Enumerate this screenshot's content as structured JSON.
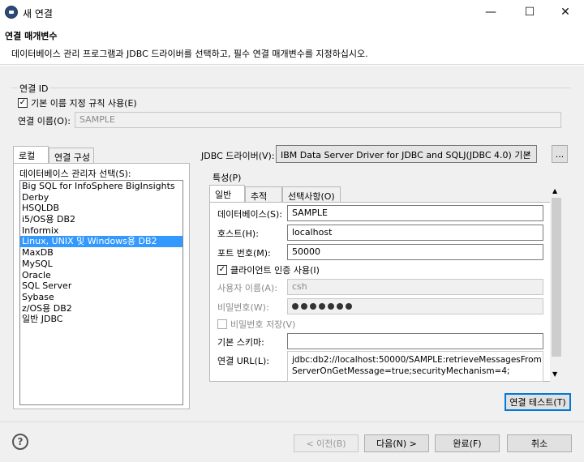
{
  "window": {
    "title": "새 연결",
    "minimize_glyph": "—",
    "maximize_glyph": "☐",
    "close_glyph": "✕"
  },
  "header": {
    "title": "연결 매개변수",
    "description": "데이터베이스 관리 프로그램과 JDBC 드라이버를 선택하고, 필수 연결 매개변수를 지정하십시오."
  },
  "connection_id": {
    "group_label": "연결 ID",
    "use_default_naming_label": "기본 이름 지정 규칙 사용(E)",
    "use_default_naming_checked": true,
    "name_label": "연결 이름(O):",
    "name_value": "SAMPLE"
  },
  "left_panel": {
    "tabs": [
      "로컬",
      "연결 구성"
    ],
    "list_label": "데이터베이스 관리자 선택(S):",
    "items": [
      "Big SQL for InfoSphere BigInsights",
      "Derby",
      "HSQLDB",
      "i5/OS용 DB2",
      "Informix",
      "Linux, UNIX 및 Windows용 DB2",
      "MaxDB",
      "MySQL",
      "Oracle",
      "SQL Server",
      "Sybase",
      "z/OS용 DB2",
      "일반 JDBC"
    ],
    "selected_index": 5
  },
  "driver": {
    "label": "JDBC 드라이버(V):",
    "selected": "IBM Data Server Driver for JDBC and SQLJ(JDBC 4.0) 기본",
    "browse_label": "..."
  },
  "properties": {
    "group_label": "특성(P)",
    "tabs": [
      "일반",
      "추적",
      "선택사항(O)"
    ],
    "database_label": "데이터베이스(S):",
    "database_value": "SAMPLE",
    "host_label": "호스트(H):",
    "host_value": "localhost",
    "port_label": "포트 번호(M):",
    "port_value": "50000",
    "client_auth_label": "클라이언트 인증 사용(I)",
    "client_auth_checked": true,
    "username_label": "사용자 이름(A):",
    "username_value": "csh",
    "password_label": "비밀번호(W):",
    "password_dots": 7,
    "save_password_label": "비밀번호 저장(V)",
    "save_password_checked": false,
    "default_schema_label": "기본 스키마:",
    "default_schema_value": "",
    "url_label": "연결 URL(L):",
    "url_line1": "jdbc:db2://localhost:50000/SAMPLE:retrieveMessagesFrom",
    "url_line2": "ServerOnGetMessage=true;securityMechanism=4;"
  },
  "test_connection_label": "연결 테스트(T)",
  "footer": {
    "help_glyph": "?",
    "back_label": "< 이전(B)",
    "next_label": "다음(N) >",
    "finish_label": "완료(F)",
    "cancel_label": "취소"
  }
}
